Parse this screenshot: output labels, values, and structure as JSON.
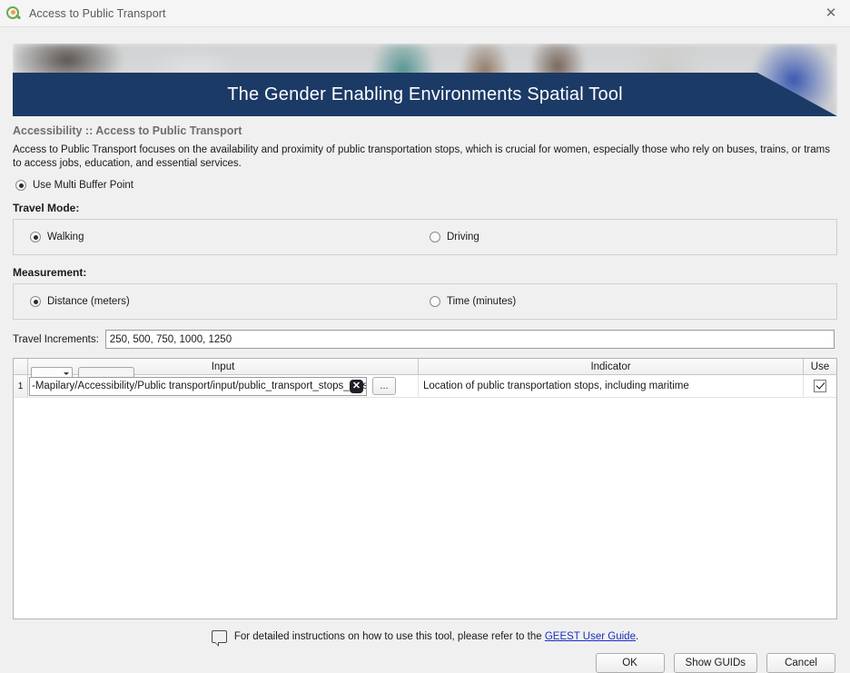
{
  "window": {
    "title": "Access to Public Transport",
    "app_icon": "qgis-logo-icon",
    "close_label": "✕"
  },
  "banner": {
    "title": "The Gender Enabling Environments Spatial Tool",
    "band_color": "#1b3a66"
  },
  "header": {
    "section_heading": "Accessibility :: Access to Public Transport",
    "description": "Access to Public Transport focuses on the availability and proximity of public transportation stops, which is crucial for women, especially those who rely on buses, trains, or trams to access jobs, education, and essential services."
  },
  "multi_buffer": {
    "label": "Use Multi Buffer Point",
    "checked": true
  },
  "travel_mode": {
    "group_label": "Travel Mode:",
    "options": [
      {
        "label": "Walking",
        "checked": true
      },
      {
        "label": "Driving",
        "checked": false
      }
    ]
  },
  "measurement": {
    "group_label": "Measurement:",
    "options": [
      {
        "label": "Distance (meters)",
        "checked": true
      },
      {
        "label": "Time (minutes)",
        "checked": false
      }
    ]
  },
  "travel_increments": {
    "label": "Travel Increments:",
    "value": "250, 500, 750, 1000, 1250",
    "placeholder": ""
  },
  "table": {
    "columns": [
      "",
      "Input",
      "Indicator",
      "Use"
    ],
    "rows": [
      {
        "row_number": "1",
        "input_path": "-Mapilary/Accessibility/Public transport/input/public_transport_stops_all.shp",
        "clear_label": "✕",
        "browse_label": "...",
        "indicator": "Location of public transportation stops, including maritime",
        "use_checked": true
      }
    ]
  },
  "footer": {
    "help_icon": "speech-bubble-icon",
    "help_text_before": "For detailed instructions on how to use this tool, please refer to the ",
    "help_link": "GEEST User Guide",
    "help_text_after": ".",
    "buttons": [
      {
        "name": "ok",
        "label": "OK"
      },
      {
        "name": "show-guids",
        "label": "Show GUIDs"
      },
      {
        "name": "cancel",
        "label": "Cancel"
      }
    ]
  }
}
